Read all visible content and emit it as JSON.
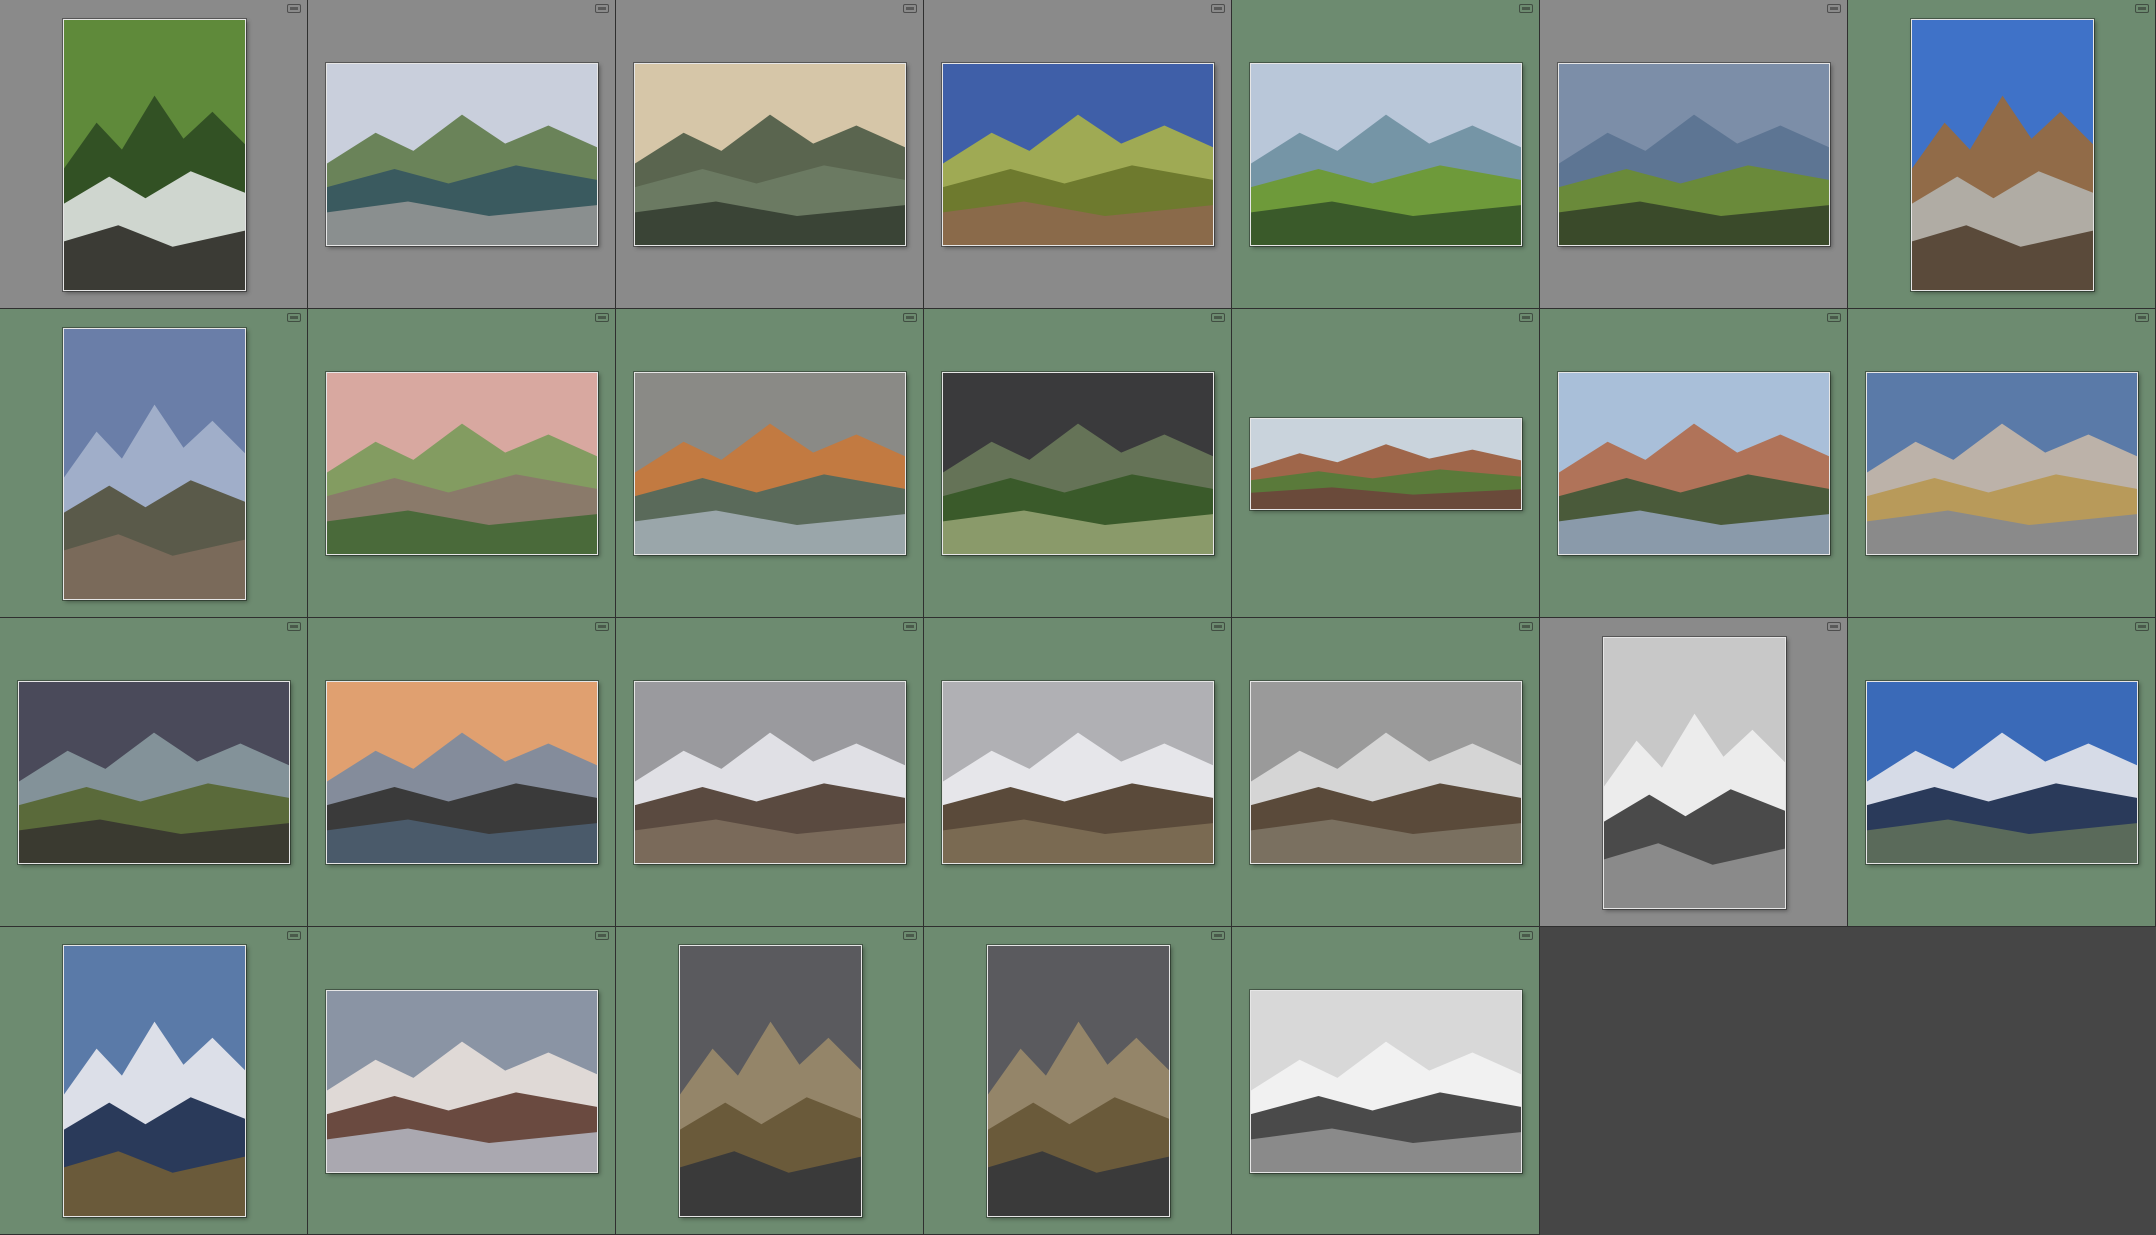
{
  "grid": {
    "columns": 7,
    "rows": 4,
    "selection_color": "#6d8b70",
    "unselected_color": "#8a8a8a",
    "empty_color": "#464646"
  },
  "items": [
    {
      "index": 1,
      "state": "unselected",
      "orientation": "portrait",
      "scene": "forest-stream-icon",
      "palette": [
        "#5f8a3a",
        "#2e4a22",
        "#cfd6cf",
        "#3b3b35"
      ]
    },
    {
      "index": 2,
      "state": "unselected",
      "orientation": "landscape",
      "scene": "coastal-inlet-icon",
      "palette": [
        "#c9cfdc",
        "#5f7a4a",
        "#3a5a5f",
        "#8a8f8f"
      ]
    },
    {
      "index": 3,
      "state": "unselected",
      "orientation": "landscape",
      "scene": "mountain-valley-icon",
      "palette": [
        "#d6c6a8",
        "#4c5a45",
        "#6b7a62",
        "#3a4436"
      ]
    },
    {
      "index": 4,
      "state": "unselected",
      "orientation": "landscape",
      "scene": "tower-field-icon",
      "palette": [
        "#3f5fa8",
        "#aab24a",
        "#6e7a2e",
        "#8a6a4a"
      ]
    },
    {
      "index": 5,
      "state": "selected",
      "orientation": "landscape",
      "scene": "coastal-path-icon",
      "palette": [
        "#b9c7d9",
        "#6e8fa0",
        "#6e9a3a",
        "#3a5a2a"
      ]
    },
    {
      "index": 6,
      "state": "unselected",
      "orientation": "landscape",
      "scene": "coastal-headland-icon",
      "palette": [
        "#7c8ea8",
        "#5a7290",
        "#6a8a3a",
        "#3a4a2a"
      ]
    },
    {
      "index": 7,
      "state": "selected",
      "orientation": "portrait",
      "scene": "rocky-hill-icon",
      "palette": [
        "#3f72c8",
        "#9a6a3a",
        "#b0aca4",
        "#5a4a3a"
      ]
    },
    {
      "index": 8,
      "state": "selected",
      "orientation": "portrait",
      "scene": "misty-pier-icon",
      "palette": [
        "#6a7ea8",
        "#a6b4cc",
        "#5a5a4a",
        "#7a6a5a"
      ]
    },
    {
      "index": 9,
      "state": "selected",
      "orientation": "landscape",
      "scene": "rock-tor-icon",
      "palette": [
        "#d8a8a0",
        "#7a9a5a",
        "#8a7a6a",
        "#4a6a3a"
      ]
    },
    {
      "index": 10,
      "state": "selected",
      "orientation": "landscape",
      "scene": "lake-hills-icon",
      "palette": [
        "#8a8a86",
        "#c8783a",
        "#5a6a5a",
        "#9aa6aa"
      ]
    },
    {
      "index": 11,
      "state": "selected",
      "orientation": "landscape",
      "scene": "storm-tree-icon",
      "palette": [
        "#3a3a3c",
        "#6a7a5a",
        "#3a5a2a",
        "#8a9a6a"
      ]
    },
    {
      "index": 12,
      "state": "selected",
      "orientation": "panorama",
      "scene": "autumn-peaks-icon",
      "palette": [
        "#c9d3dc",
        "#9a5a3a",
        "#5a7a3a",
        "#6a4a3a"
      ]
    },
    {
      "index": 13,
      "state": "selected",
      "orientation": "landscape",
      "scene": "lake-woodland-icon",
      "palette": [
        "#a9bfd9",
        "#b06a4a",
        "#4a5a3a",
        "#8a9aaa"
      ]
    },
    {
      "index": 14,
      "state": "selected",
      "orientation": "landscape",
      "scene": "harbour-wall-icon",
      "palette": [
        "#5a7aa8",
        "#c6b8a8",
        "#b89a5a",
        "#8a8a8a"
      ]
    },
    {
      "index": 15,
      "state": "selected",
      "orientation": "landscape",
      "scene": "lighthouse-coast-icon",
      "palette": [
        "#4a4a5a",
        "#8a9aa0",
        "#5a6a3a",
        "#3a3a30"
      ]
    },
    {
      "index": 16,
      "state": "selected",
      "orientation": "landscape",
      "scene": "mountain-reflection-icon",
      "palette": [
        "#e0a070",
        "#7a8aa0",
        "#3a3a3a",
        "#4a5a6a"
      ]
    },
    {
      "index": 17,
      "state": "selected",
      "orientation": "landscape",
      "scene": "snowy-mountain-icon",
      "palette": [
        "#9a9a9e",
        "#e8e8ec",
        "#5a4a40",
        "#7a6a5a"
      ]
    },
    {
      "index": 18,
      "state": "selected",
      "orientation": "landscape",
      "scene": "snowy-peak-icon",
      "palette": [
        "#b0b0b4",
        "#ececf0",
        "#5a4a3a",
        "#7a6a52"
      ]
    },
    {
      "index": 19,
      "state": "selected",
      "orientation": "landscape",
      "scene": "misty-snow-glen-icon",
      "palette": [
        "#9a9a9a",
        "#dcdcdc",
        "#5a4a3a",
        "#7a7060"
      ]
    },
    {
      "index": 20,
      "state": "unselected",
      "orientation": "portrait",
      "scene": "monochrome-glen-icon",
      "palette": [
        "#c8c8c8",
        "#f0f0f0",
        "#4a4a4a",
        "#8a8a8a"
      ]
    },
    {
      "index": 21,
      "state": "selected",
      "orientation": "landscape",
      "scene": "peak-reflection-icon",
      "palette": [
        "#3a6ab8",
        "#e8e8ec",
        "#2a3a5a",
        "#5a6a5a"
      ]
    },
    {
      "index": 22,
      "state": "selected",
      "orientation": "portrait",
      "scene": "peak-lake-reflection-icon",
      "palette": [
        "#5a7aa8",
        "#eaeaee",
        "#2a3a5a",
        "#6a5a3a"
      ]
    },
    {
      "index": 23,
      "state": "selected",
      "orientation": "landscape",
      "scene": "loch-mountain-icon",
      "palette": [
        "#8a94a4",
        "#e8e0dc",
        "#6a4a40",
        "#aaa8b0"
      ]
    },
    {
      "index": 24,
      "state": "selected",
      "orientation": "portrait",
      "scene": "glen-road-icon",
      "palette": [
        "#5a5a5e",
        "#9a8a6a",
        "#6a5a3a",
        "#3a3a3a"
      ]
    },
    {
      "index": 25,
      "state": "selected",
      "orientation": "portrait",
      "scene": "glen-road-icon",
      "palette": [
        "#5a5a5e",
        "#9a8a6a",
        "#6a5a3a",
        "#3a3a3a"
      ]
    },
    {
      "index": 26,
      "state": "selected",
      "orientation": "landscape",
      "scene": "monochrome-waterfall-icon",
      "palette": [
        "#d8d8d8",
        "#f4f4f4",
        "#4a4a4a",
        "#8a8a8a"
      ]
    }
  ]
}
